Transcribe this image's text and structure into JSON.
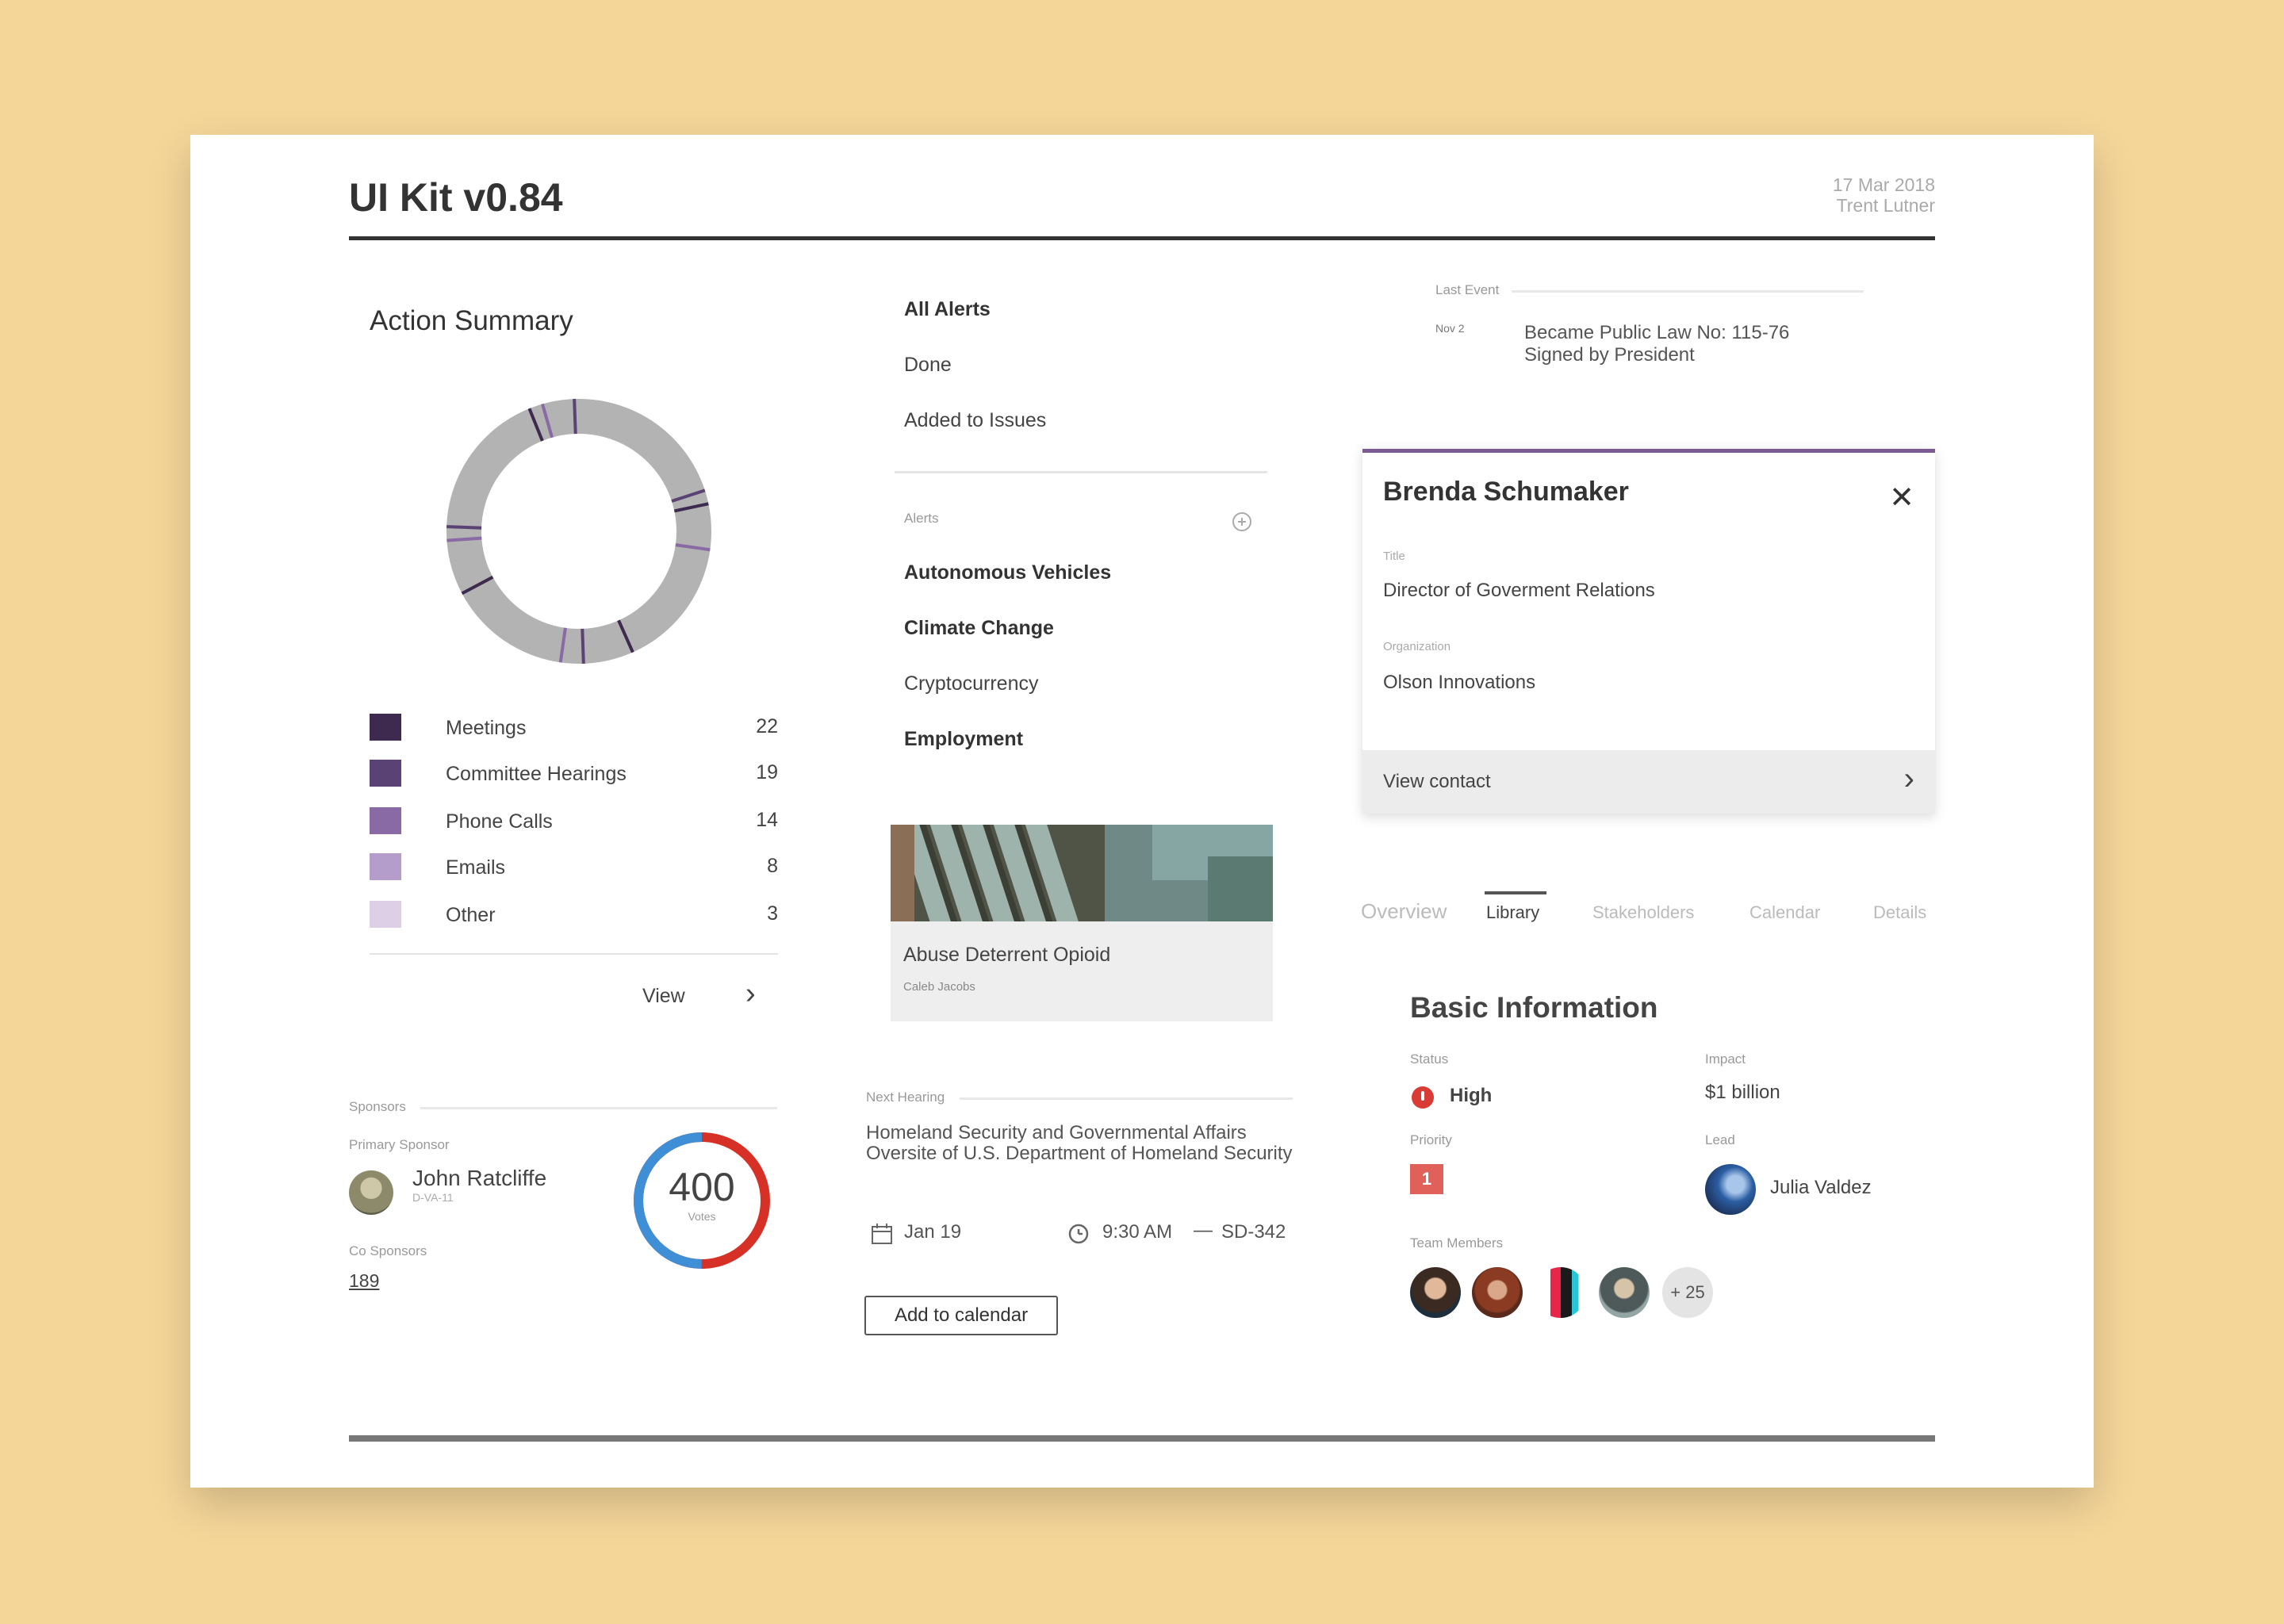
{
  "header": {
    "title": "UI Kit v0.84",
    "date": "17 Mar 2018",
    "author": "Trent Lutner"
  },
  "action_summary": {
    "title": "Action Summary",
    "legend": [
      {
        "label": "Meetings",
        "count": "22",
        "color": "#3d2a4e"
      },
      {
        "label": "Committee Hearings",
        "count": "19",
        "color": "#5b4275"
      },
      {
        "label": "Phone Calls",
        "count": "14",
        "color": "#8a6aa5"
      },
      {
        "label": "Emails",
        "count": "8",
        "color": "#b59dcb"
      },
      {
        "label": "Other",
        "count": "3",
        "color": "#dccfe6"
      }
    ],
    "view_label": "View",
    "ring_color": "#b3b3b3"
  },
  "sponsors": {
    "section_label": "Sponsors",
    "primary_label": "Primary Sponsor",
    "primary_name": "John Ratcliffe",
    "primary_sub": "D-VA-11",
    "co_label": "Co Sponsors",
    "co_count": "189",
    "votes_value": "400",
    "votes_label": "Votes",
    "ring_colors": {
      "blue": "#3f8fd6",
      "red": "#d63027"
    }
  },
  "alerts": {
    "filters": [
      "All Alerts",
      "Done",
      "Added to Issues"
    ],
    "section_label": "Alerts",
    "topics": [
      "Autonomous Vehicles",
      "Climate Change",
      "Cryptocurrency",
      "Employment"
    ]
  },
  "image_card": {
    "title": "Abuse Deterrent Opioid",
    "subtitle": "Caleb Jacobs"
  },
  "next_hearing": {
    "section_label": "Next Hearing",
    "description": "Homeland Security and Governmental Affairs Oversite of U.S. Department of Homeland Security",
    "date": "Jan 19",
    "time": "9:30 AM",
    "dash": "—",
    "room": "SD-342",
    "add_button": "Add to calendar"
  },
  "last_event": {
    "section_label": "Last Event",
    "date": "Nov 2",
    "line1": "Became Public Law No: 115-76",
    "line2": "Signed by President"
  },
  "contact": {
    "name": "Brenda Schumaker",
    "close_glyph": "✕",
    "title_label": "Title",
    "title_value": "Director of Goverment Relations",
    "org_label": "Organization",
    "org_value": "Olson Innovations",
    "footer_label": "View contact",
    "accent": "#7a5c93"
  },
  "tabs": [
    "Overview",
    "Library",
    "Stakeholders",
    "Calendar",
    "Details"
  ],
  "basic_info": {
    "title": "Basic Information",
    "status_label": "Status",
    "status_value": "High",
    "impact_label": "Impact",
    "impact_value": "$1 billion",
    "priority_label": "Priority",
    "priority_value": "1",
    "lead_label": "Lead",
    "lead_name": "Julia Valdez",
    "team_label": "Team Members",
    "team_more": "+ 25"
  }
}
